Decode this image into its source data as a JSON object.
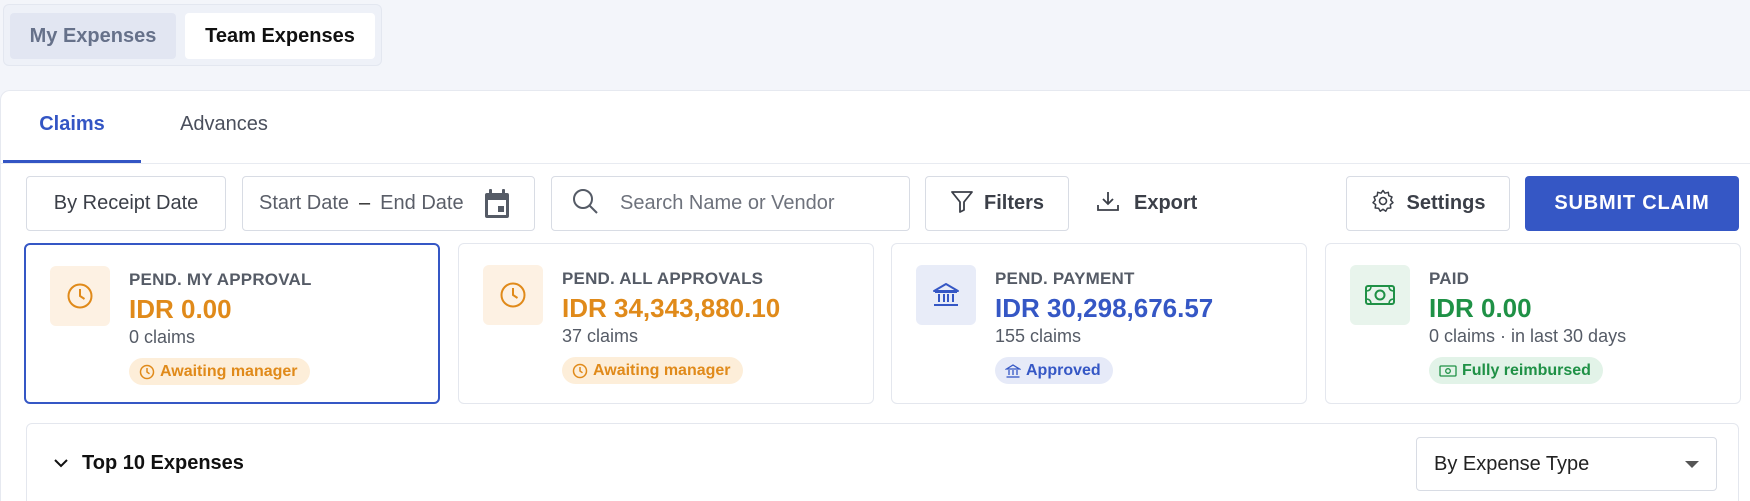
{
  "top_tabs": {
    "my_expenses": "My Expenses",
    "team_expenses": "Team Expenses"
  },
  "sub_tabs": {
    "claims": "Claims",
    "advances": "Advances"
  },
  "toolbar": {
    "receipt_date": "By Receipt Date",
    "start_date": "Start Date",
    "date_separator": "–",
    "end_date": "End Date",
    "search_placeholder": "Search Name or Vendor",
    "filters": "Filters",
    "export": "Export",
    "settings": "Settings",
    "submit": "SUBMIT CLAIM"
  },
  "cards": [
    {
      "title": "PEND. MY APPROVAL",
      "amount": "IDR 0.00",
      "count": "0 claims",
      "badge": "Awaiting manager",
      "icon": "clock-icon"
    },
    {
      "title": "PEND. ALL APPROVALS",
      "amount": "IDR 34,343,880.10",
      "count": "37 claims",
      "badge": "Awaiting manager",
      "icon": "clock-icon"
    },
    {
      "title": "PEND. PAYMENT",
      "amount": "IDR 30,298,676.57",
      "count": "155 claims",
      "badge": "Approved",
      "icon": "bank-icon"
    },
    {
      "title": "PAID",
      "amount": "IDR 0.00",
      "count": "0 claims · in last 30 days",
      "badge": "Fully reimbursed",
      "icon": "cash-icon"
    }
  ],
  "top10": {
    "title": "Top 10 Expenses",
    "group_by": "By Expense Type"
  },
  "colors": {
    "accent": "#3557c5",
    "orange": "#e08a1a",
    "green": "#1f9146"
  }
}
